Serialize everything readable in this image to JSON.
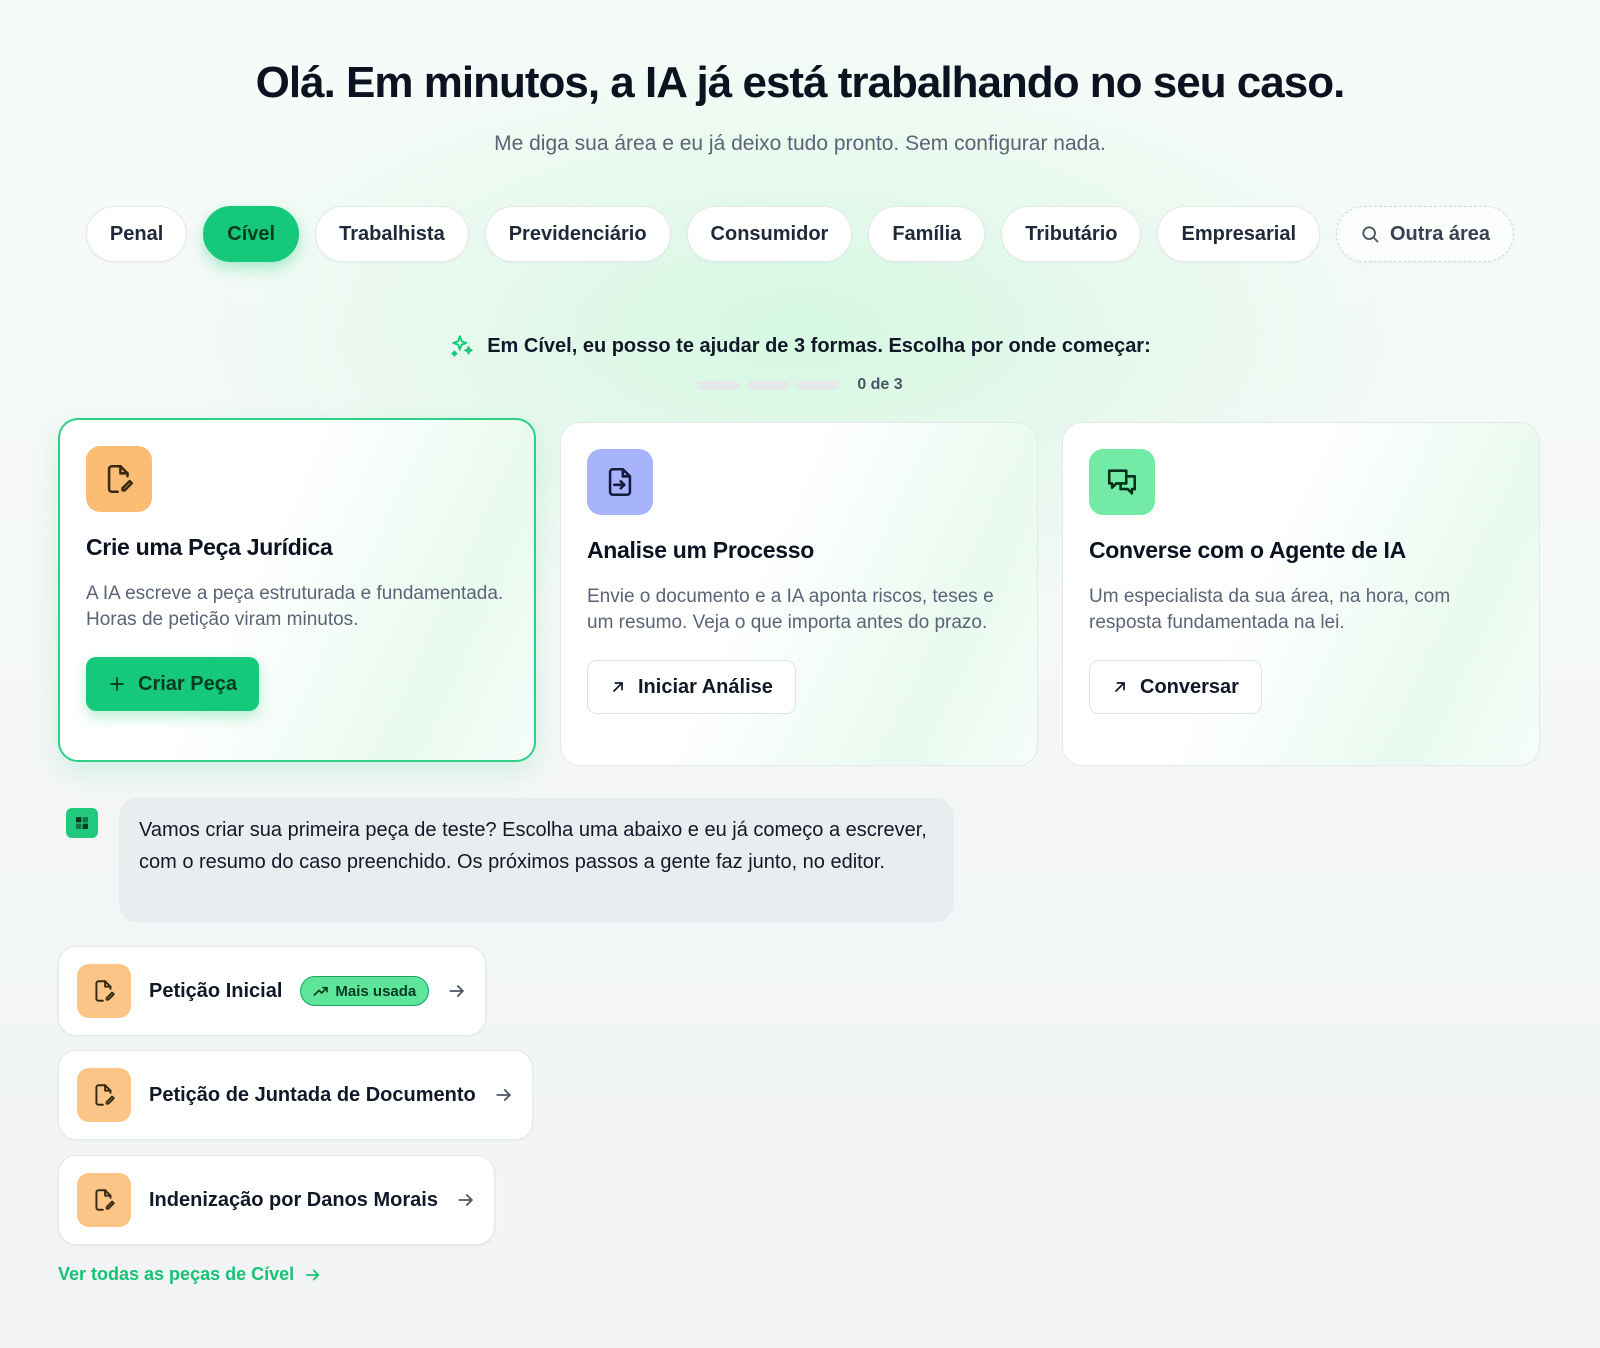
{
  "header": {
    "title": "Olá. Em minutos, a IA já está trabalhando no seu caso.",
    "subtitle": "Me diga sua área e eu já deixo tudo pronto. Sem configurar nada."
  },
  "areas": {
    "items": [
      {
        "label": "Penal",
        "active": false
      },
      {
        "label": "Cível",
        "active": true
      },
      {
        "label": "Trabalhista",
        "active": false
      },
      {
        "label": "Previdenciário",
        "active": false
      },
      {
        "label": "Consumidor",
        "active": false
      },
      {
        "label": "Família",
        "active": false
      },
      {
        "label": "Tributário",
        "active": false
      },
      {
        "label": "Empresarial",
        "active": false
      }
    ],
    "other_label": "Outra área"
  },
  "intro": {
    "text": "Em Cível, eu posso te ajudar de 3 formas. Escolha por onde começar:",
    "progress_label": "0 de 3",
    "progress_value": 0,
    "progress_total": 3
  },
  "cards": [
    {
      "title": "Crie uma Peça Jurídica",
      "description": "A IA escreve a peça estruturada e fundamentada. Horas de petição viram minutos.",
      "button": "Criar Peça",
      "icon": "document-edit-icon"
    },
    {
      "title": "Analise um Processo",
      "description": "Envie o documento e a IA aponta riscos, teses e um resumo. Veja o que importa antes do prazo.",
      "button": "Iniciar Análise",
      "icon": "document-import-icon"
    },
    {
      "title": "Converse com o Agente de IA",
      "description": "Um especialista da sua área, na hora, com resposta fundamentada na lei.",
      "button": "Conversar",
      "icon": "chat-bubbles-icon"
    }
  ],
  "assistant": {
    "message": "Vamos criar sua primeira peça de teste? Escolha uma abaixo e eu já começo a escrever, com o resumo do caso preenchido. Os próximos passos a gente faz junto, no editor."
  },
  "pieces": [
    {
      "label": "Petição Inicial",
      "badge": "Mais usada"
    },
    {
      "label": "Petição de Juntada de Documento",
      "badge": ""
    },
    {
      "label": "Indenização por Danos Morais",
      "badge": ""
    }
  ],
  "footer_link": "Ver todas as peças de Cível",
  "colors": {
    "accent": "#16c97a",
    "accent_text": "#17c277",
    "icon_orange": "#fbbd74",
    "icon_blue": "#a7b3fb",
    "icon_green": "#74eaa7"
  }
}
